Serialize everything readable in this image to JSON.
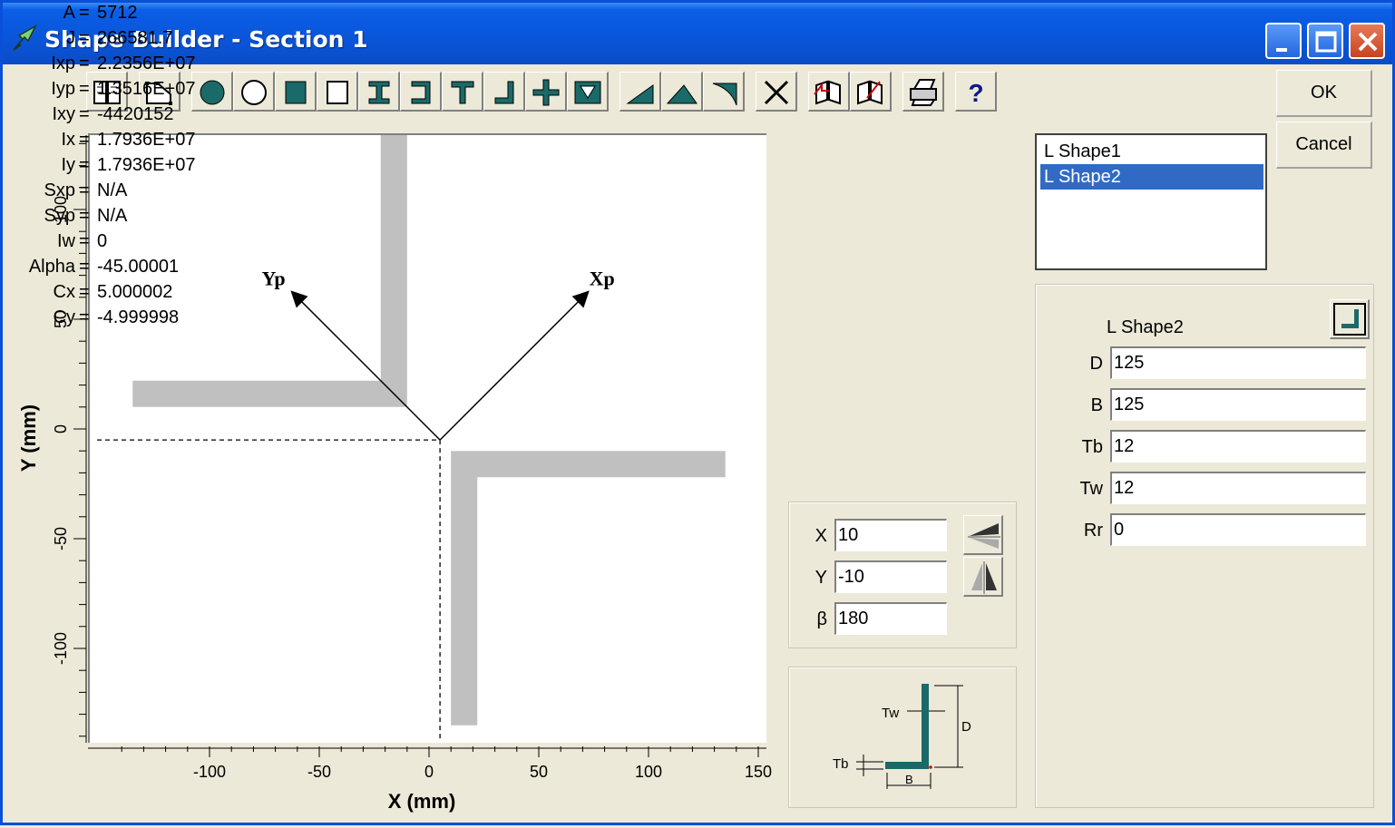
{
  "window": {
    "title": "Shape Builder  - Section 1"
  },
  "buttons": {
    "ok": "OK",
    "cancel": "Cancel"
  },
  "toolbar": [
    {
      "name": "library-icon"
    },
    {
      "name": "polygon-icon"
    },
    {
      "name": "filled-circle-icon"
    },
    {
      "name": "hollow-circle-icon"
    },
    {
      "name": "filled-rectangle-icon"
    },
    {
      "name": "hollow-rectangle-icon"
    },
    {
      "name": "i-section-icon"
    },
    {
      "name": "channel-section-icon"
    },
    {
      "name": "tee-section-icon"
    },
    {
      "name": "angle-section-icon"
    },
    {
      "name": "cross-section-icon"
    },
    {
      "name": "box-section-icon"
    },
    {
      "name": "right-triangle-icon"
    },
    {
      "name": "triangle-icon"
    },
    {
      "name": "fillet-icon"
    },
    {
      "name": "delete-icon"
    },
    {
      "name": "open-book-icon"
    },
    {
      "name": "save-book-icon"
    },
    {
      "name": "print-icon"
    },
    {
      "name": "help-icon"
    }
  ],
  "properties": [
    {
      "label": "A",
      "value": "5712"
    },
    {
      "label": "J",
      "value": "266581.7"
    },
    {
      "label": "Ixp",
      "value": "2.2356E+07"
    },
    {
      "label": "Iyp",
      "value": "1.3516E+07"
    },
    {
      "label": "Ixy",
      "value": "-4420152"
    },
    {
      "label": "Ix",
      "value": "1.7936E+07"
    },
    {
      "label": "Iy",
      "value": "1.7936E+07"
    },
    {
      "label": "Sxp",
      "value": "N/A"
    },
    {
      "label": "Syp",
      "value": "N/A"
    },
    {
      "label": "Iw",
      "value": "0"
    },
    {
      "label": "Alpha",
      "value": "-45.00001"
    },
    {
      "label": "Cx",
      "value": "5.000002"
    },
    {
      "label": "Cy",
      "value": "-4.999998"
    }
  ],
  "shapes_list": [
    {
      "label": "L Shape1",
      "selected": false
    },
    {
      "label": "L Shape2",
      "selected": true
    }
  ],
  "placement": {
    "x_label": "X",
    "x_value": "10",
    "y_label": "Y",
    "y_value": "-10",
    "beta_label": "β",
    "beta_value": "180"
  },
  "shape_params": {
    "title": "L Shape2",
    "fields": [
      {
        "label": "D",
        "value": "125"
      },
      {
        "label": "B",
        "value": "125"
      },
      {
        "label": "Tb",
        "value": "12"
      },
      {
        "label": "Tw",
        "value": "12"
      },
      {
        "label": "Rr",
        "value": "0"
      }
    ]
  },
  "diagram_labels": {
    "tw": "Tw",
    "tb": "Tb",
    "d": "D",
    "b": "B"
  },
  "plot": {
    "xlabel": "X (mm)",
    "ylabel": "Y (mm)",
    "x_ticks": [
      "-100",
      "-50",
      "0",
      "50",
      "100",
      "150"
    ],
    "y_ticks": [
      "100",
      "50",
      "0",
      "-50",
      "-100"
    ],
    "axis_xp": "Xp",
    "axis_yp": "Yp"
  },
  "colors": {
    "shape_fill": "#c0c0c0",
    "accent": "#1a6a6a",
    "selection": "#316ac5"
  }
}
